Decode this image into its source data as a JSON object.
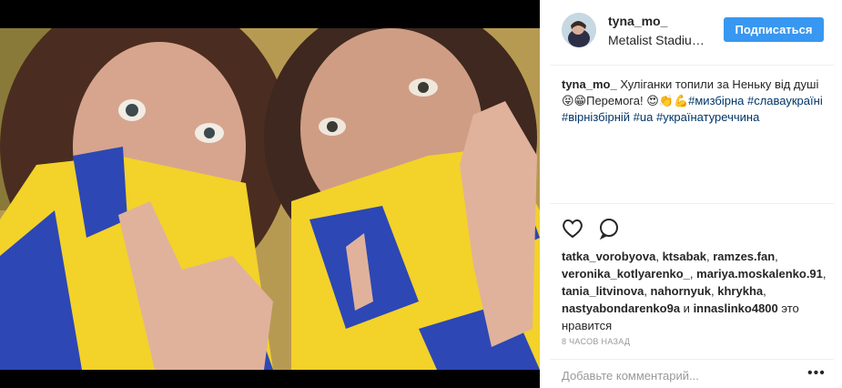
{
  "post": {
    "username": "tyna_mo_",
    "location": "Metalist Stadiu…",
    "follow_label": "Подписаться",
    "caption_text": "Хуліганки топили за Неньку від душі😝😁Перемога! 😍👏💪",
    "hashtags": [
      "#мизбірна",
      "#славаукраїні",
      "#вірнізбірній",
      "#ua",
      "#українатуреччина"
    ],
    "likers": [
      "tatka_vorobyova",
      "ktsabak",
      "ramzes.fan",
      "veronika_kotlyarenko_",
      "mariya.moskalenko.91",
      "tania_litvinova",
      "nahornyuk",
      "khrykha",
      "nastyabondarenko9a",
      "innaslinko4800"
    ],
    "likes_and": "и",
    "likes_suffix": "это нравится",
    "timestamp": "8 часов назад",
    "comment_placeholder": "Добавьте комментарий...",
    "more_label": "•••"
  },
  "icons": {
    "like": "heart-icon",
    "comment": "comment-bubble-icon",
    "more": "more-options-icon"
  },
  "colors": {
    "follow_button": "#3897f0",
    "hashtag": "#003569",
    "muted": "#999999",
    "photo_letterbox": "#000000"
  }
}
